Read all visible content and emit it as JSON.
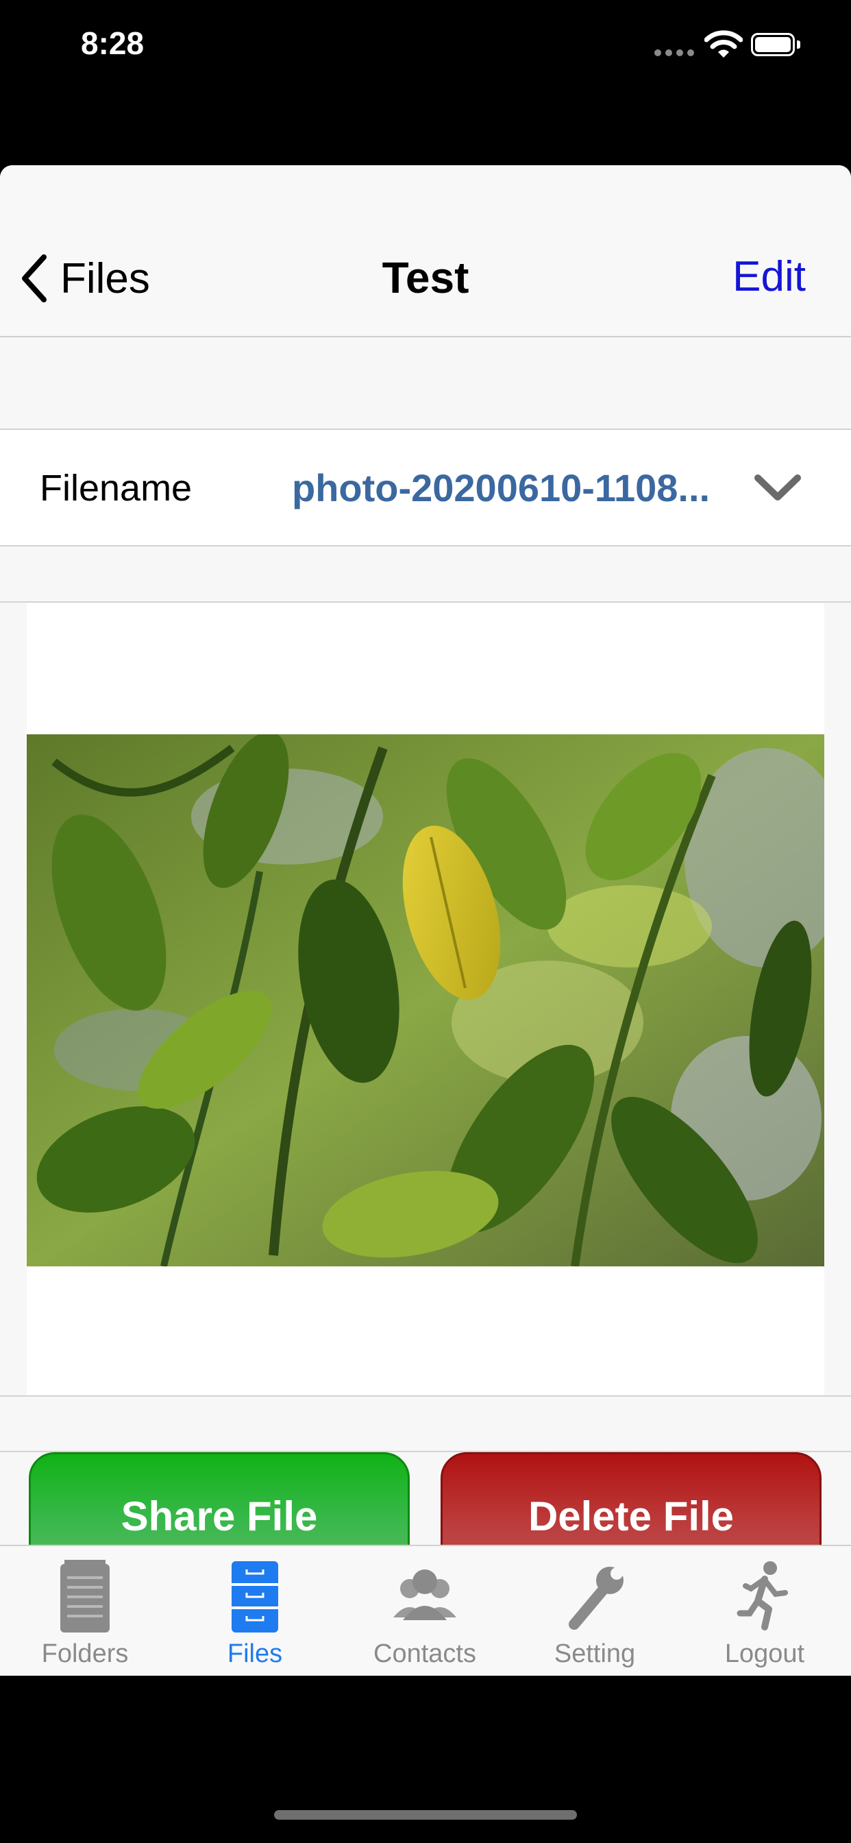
{
  "status_bar": {
    "time": "8:28"
  },
  "nav": {
    "back_label": "Files",
    "title": "Test",
    "edit_label": "Edit"
  },
  "file": {
    "label": "Filename",
    "value": "photo-20200610-1108..."
  },
  "actions": {
    "share_label": "Share File",
    "delete_label": "Delete File"
  },
  "tabs": [
    {
      "label": "Folders",
      "icon": "folders-icon"
    },
    {
      "label": "Files",
      "icon": "files-icon",
      "active": true
    },
    {
      "label": "Contacts",
      "icon": "contacts-icon"
    },
    {
      "label": "Setting",
      "icon": "wrench-icon"
    },
    {
      "label": "Logout",
      "icon": "logout-icon"
    }
  ],
  "colors": {
    "edit": "#1515d6",
    "filename": "#3b68a0",
    "share": "#11b216",
    "delete": "#b11212",
    "tab_active": "#1f7bf0",
    "tab_inactive": "#8a8a8a"
  }
}
